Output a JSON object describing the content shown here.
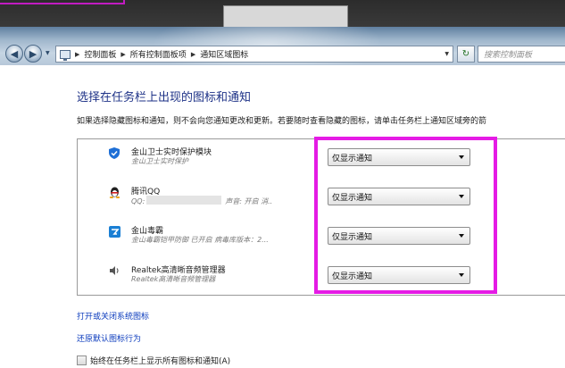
{
  "window": {
    "breadcrumb": [
      "控制面板",
      "所有控制面板项",
      "通知区域图标"
    ],
    "search_placeholder": "搜索控制面板"
  },
  "page": {
    "title": "选择在任务栏上出现的图标和通知",
    "description": "如果选择隐藏图标和通知，则不会向您通知更改和更新。若要随时查看隐藏的图标，请单击任务栏上通知区域旁的箭"
  },
  "icons": [
    {
      "name": "金山卫士实时保护模块",
      "desc": "金山卫士实时保护",
      "behavior": "仅显示通知",
      "icon": "shield-icon",
      "color": "#1e6fd6"
    },
    {
      "name": "腾讯QQ",
      "desc_prefix": "QQ:",
      "desc_suffix": "声音: 开启 消..",
      "behavior": "仅显示通知",
      "icon": "qq-penguin-icon",
      "color": "#d22020"
    },
    {
      "name": "金山毒霸",
      "desc": "金山毒霸铠甲防御 已开启 病毒库版本：2...",
      "behavior": "仅显示通知",
      "icon": "duba-icon",
      "color": "#1a7fd4"
    },
    {
      "name": "Realtek高清晰音频管理器",
      "desc": "Realtek高清晰音频管理器",
      "behavior": "仅显示通知",
      "icon": "speaker-icon",
      "color": "#555555"
    }
  ],
  "links": {
    "system_icons": "打开或关闭系统图标",
    "restore_default": "还原默认图标行为"
  },
  "checkbox": {
    "label": "始终在任务栏上显示所有图标和通知(A)",
    "checked": false
  },
  "highlight_color": "#e51be5"
}
